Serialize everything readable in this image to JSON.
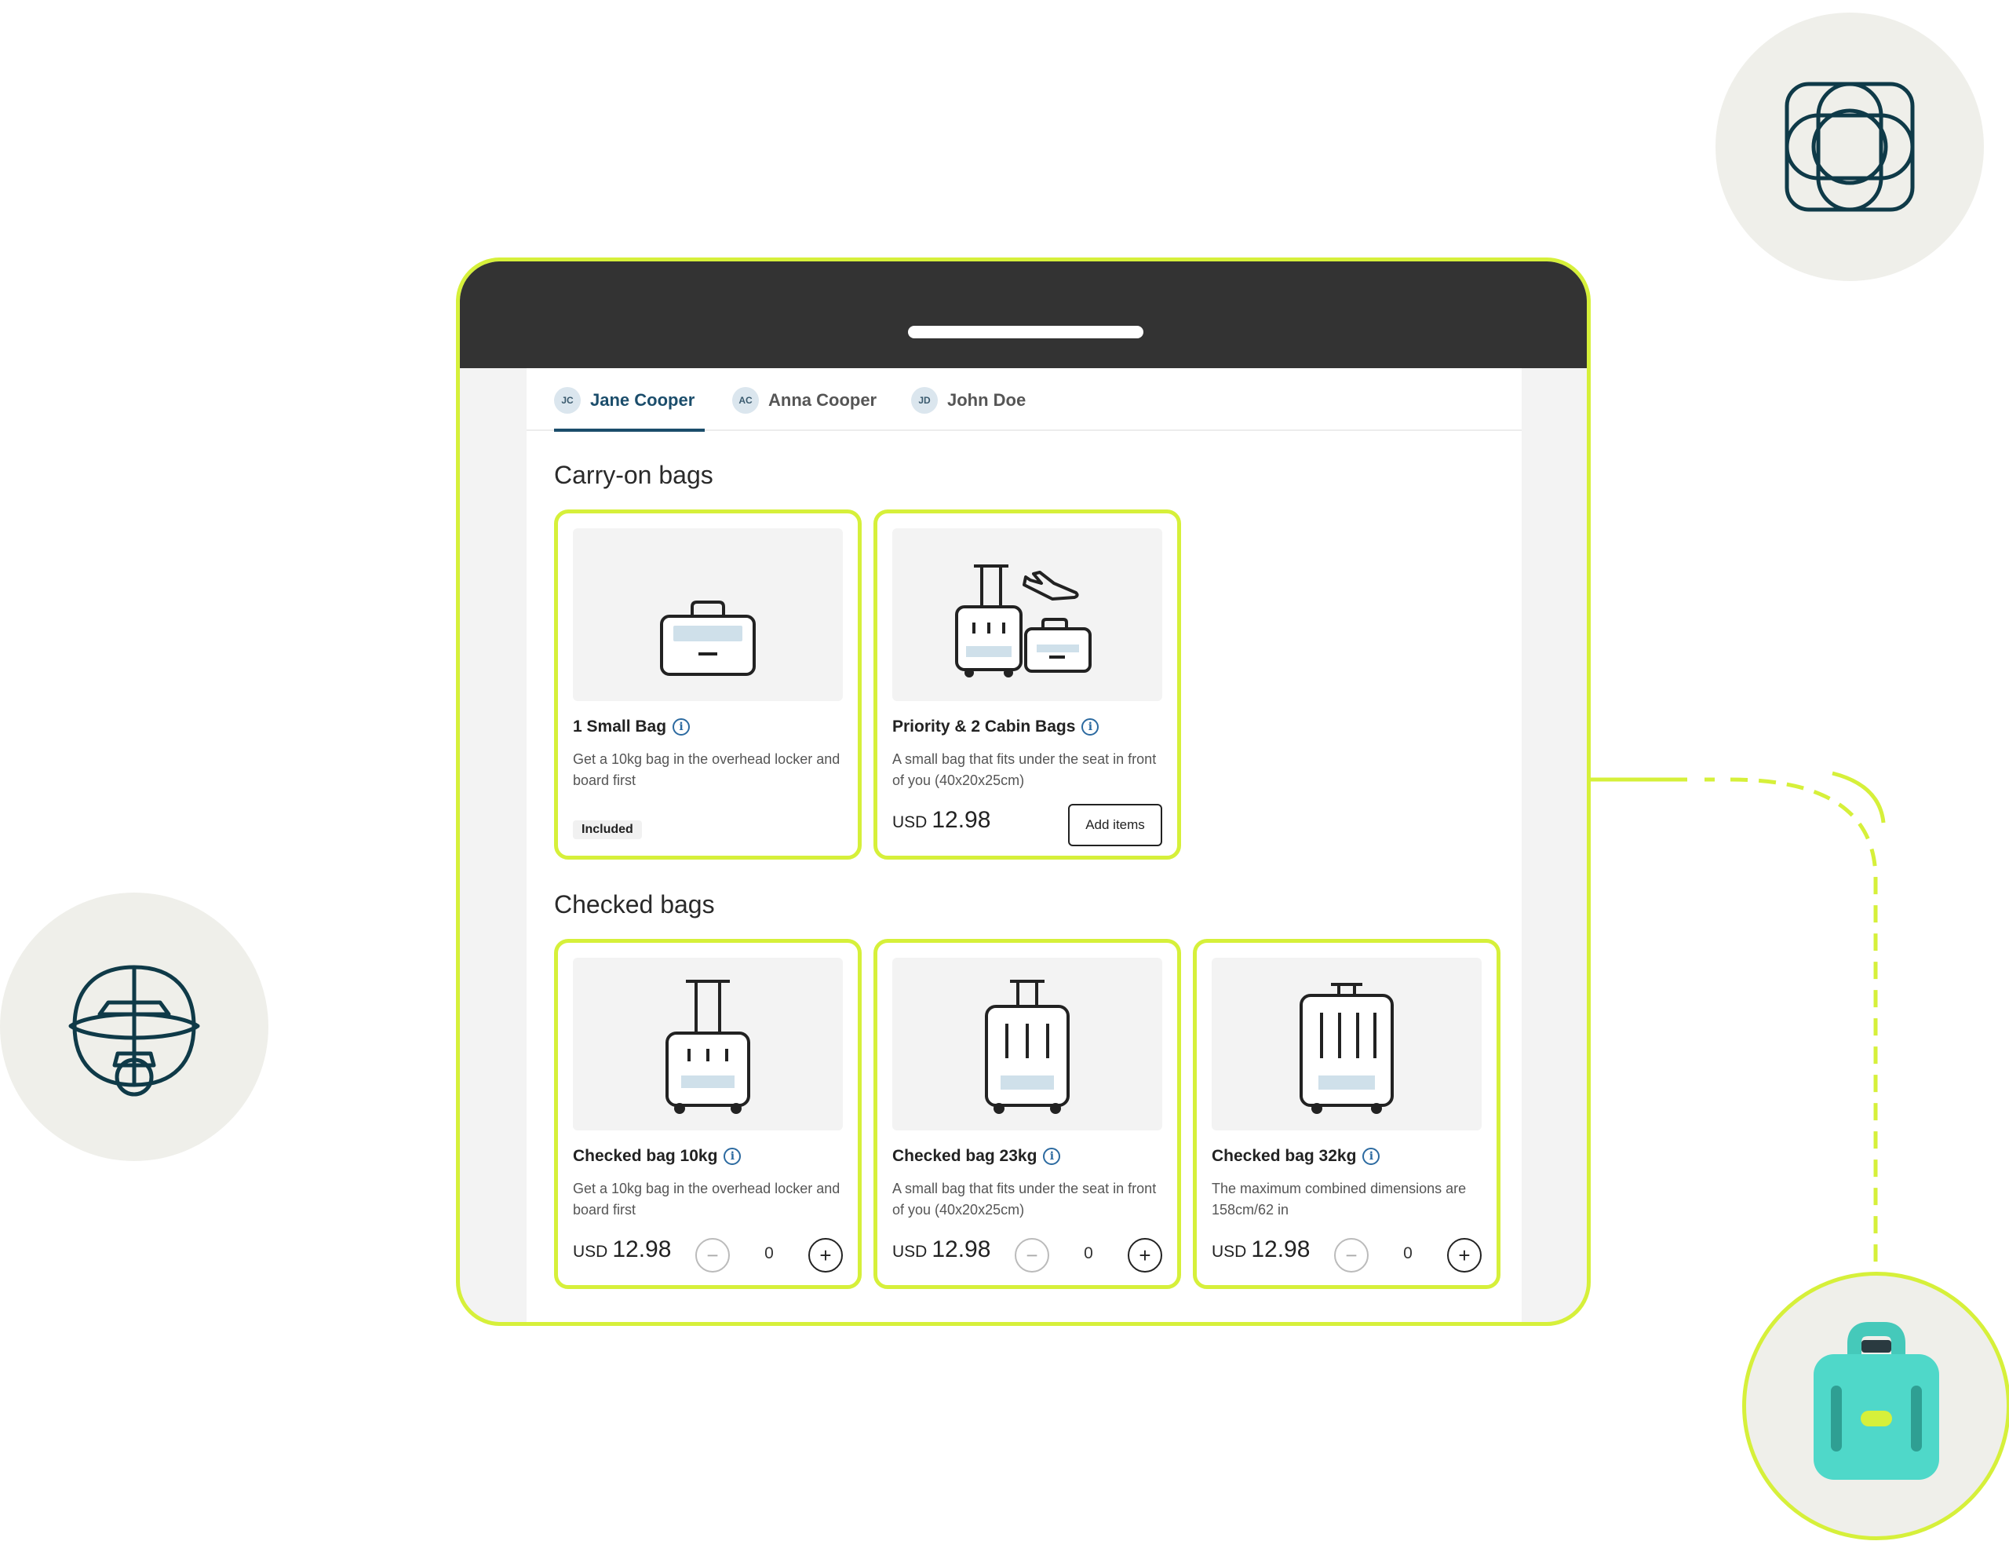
{
  "tabs": [
    {
      "initials": "JC",
      "name": "Jane Cooper",
      "active": true
    },
    {
      "initials": "AC",
      "name": "Anna Cooper",
      "active": false
    },
    {
      "initials": "JD",
      "name": "John Doe",
      "active": false
    }
  ],
  "carry_on": {
    "title": "Carry-on bags",
    "cards": [
      {
        "title": "1 Small Bag",
        "description": "Get a 10kg bag in the overhead locker and board first",
        "badge": "Included"
      },
      {
        "title": "Priority & 2 Cabin Bags",
        "description": "A small bag that fits under the seat in front of you (40x20x25cm)",
        "currency": "USD",
        "price": "12.98",
        "button": "Add items"
      }
    ]
  },
  "checked": {
    "title": "Checked bags",
    "cards": [
      {
        "title": "Checked bag 10kg",
        "description": "Get a 10kg bag in the overhead locker and board first",
        "currency": "USD",
        "price": "12.98",
        "quantity": "0"
      },
      {
        "title": "Checked bag 23kg",
        "description": "A small bag that fits under the seat in front of you (40x20x25cm)",
        "currency": "USD",
        "price": "12.98",
        "quantity": "0"
      },
      {
        "title": "Checked bag 32kg",
        "description": "The maximum combined dimensions are 158cm/62 in",
        "currency": "USD",
        "price": "12.98",
        "quantity": "0"
      }
    ]
  },
  "icons": {
    "info": "i",
    "minus": "−",
    "plus": "+",
    "decor": [
      "flower-icon",
      "plane-icon",
      "luggage-icon"
    ]
  },
  "colors": {
    "accent": "#d6f03a",
    "tab_active": "#1b4d6b",
    "device_top": "#333333",
    "luggage_teal": "#4fd8c9"
  }
}
